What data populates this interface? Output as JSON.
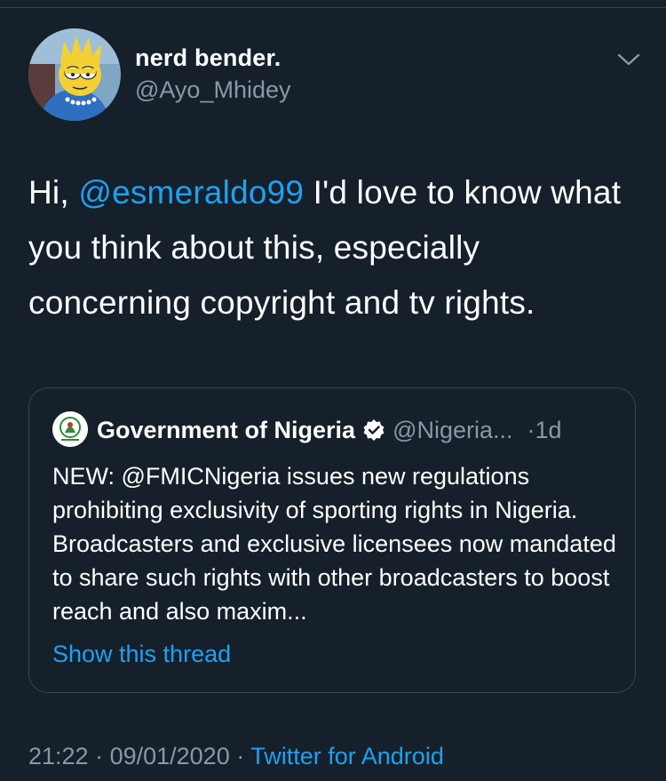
{
  "tweet": {
    "author_name": "nerd bender.",
    "author_handle": "@Ayo_Mhidey",
    "text_prefix": "Hi, ",
    "mention": "@esmeraldo99",
    "text_rest": " I'd love to know what you think about this, especially concerning copyright and tv rights.",
    "time": "21:22",
    "separator": " · ",
    "date": "09/01/2020",
    "source": "Twitter for Android"
  },
  "quoted_tweet": {
    "name": "Government of Nigeria",
    "handle": "@Nigeria...",
    "separator": "·",
    "age": "1d",
    "text": "NEW: @FMICNigeria issues new regulations prohibiting exclusivity of sporting rights in Nigeria. Broadcasters and exclusive licensees now mandated to share such rights with other broadcasters to boost reach and also maxim...",
    "show_thread_label": "Show this thread"
  },
  "icons": {
    "caret": "chevron-down-icon",
    "verified": "verified-badge-icon"
  },
  "colors": {
    "background": "#15202b",
    "accent": "#1da1f2",
    "secondary_text": "#8899a6",
    "border": "#38444d"
  }
}
